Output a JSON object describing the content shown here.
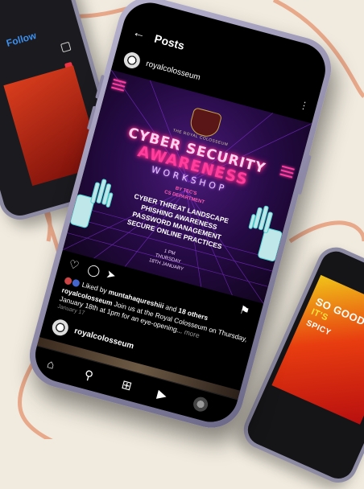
{
  "left_phone": {
    "follow_label": "Follow"
  },
  "main_phone": {
    "header": {
      "title": "Posts"
    },
    "post": {
      "username": "royalcolosseum",
      "poster": {
        "crest_text": "THE ROYAL COLOSSEUM",
        "title_line1": "CYBER SECURITY",
        "title_line2": "AWARENESS",
        "title_line3": "WORKSHOP",
        "by_line1": "BY TEC'S",
        "by_line2": "CS DEPARTMENT",
        "topics": [
          "CYBER THREAT LANDSCAPE",
          "PHISHING AWARENESS",
          "PASSWORD MANAGEMENT",
          "SECURE ONLINE PRACTICES"
        ],
        "time": "1 PM",
        "day": "THURSDAY",
        "date": "18TH JANUARY"
      },
      "likes_prefix": "Liked by",
      "likes_user": "muntahaqureshiii",
      "likes_and": "and",
      "likes_others": "18 others",
      "caption_user": "royalcolosseum",
      "caption_text": "Join us at the Royal Colosseum on Thursday, January 18th at 1pm for an eye-opening...",
      "caption_more": "more",
      "post_date": "January 17"
    },
    "next_post": {
      "username": "royalcolosseum"
    }
  },
  "right_phone": {
    "promo_line1": "SO GOOD",
    "promo_line2": "IT'S",
    "promo_line3": "SPICY"
  },
  "colors": {
    "background": "#f1ebdf",
    "accent_curve": "#e8a88a",
    "neon_pink": "#ff3d9c",
    "link_blue": "#3d8fee"
  }
}
